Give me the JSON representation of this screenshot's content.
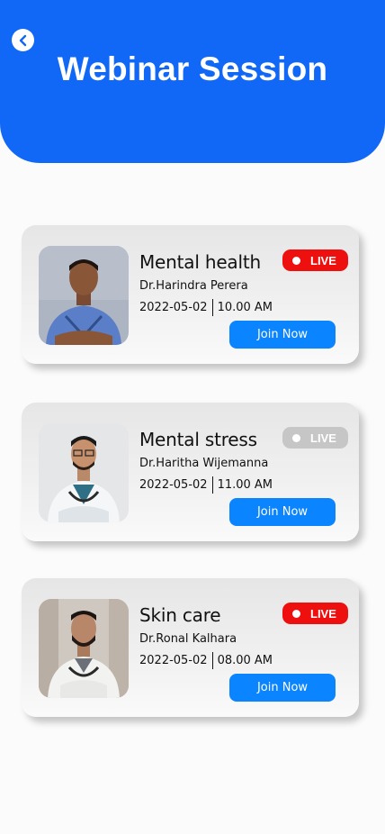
{
  "header": {
    "title": "Webinar Session",
    "back_icon": "chevron-left-icon"
  },
  "colors": {
    "header_bg": "#1168f6",
    "live_active": "#ee0f0f",
    "live_inactive": "#c6c6c6",
    "join_button": "#0a84ff"
  },
  "sessions": [
    {
      "title": "Mental health",
      "doctor": "Dr.Harindra Perera",
      "date": "2022-05-02",
      "time": "10.00 AM",
      "live_label": "LIVE",
      "live_active": true,
      "join_label": "Join Now"
    },
    {
      "title": "Mental stress",
      "doctor": "Dr.Haritha Wijemanna",
      "date": "2022-05-02",
      "time": "11.00 AM",
      "live_label": "LIVE",
      "live_active": false,
      "join_label": "Join Now"
    },
    {
      "title": "Skin care",
      "doctor": "Dr.Ronal Kalhara",
      "date": "2022-05-02",
      "time": "08.00 AM",
      "live_label": "LIVE",
      "live_active": true,
      "join_label": "Join Now"
    }
  ]
}
